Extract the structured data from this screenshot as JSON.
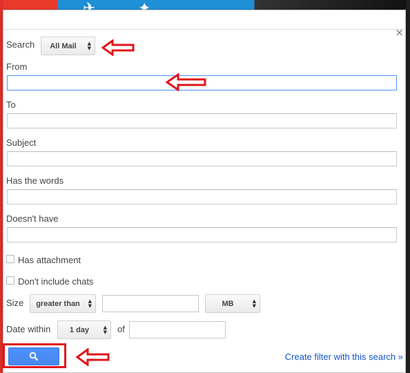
{
  "dialog": {
    "close_label": "×",
    "search_label": "Search",
    "search_scope": "All Mail",
    "from_label": "From",
    "from_value": "",
    "to_label": "To",
    "subject_label": "Subject",
    "has_words_label": "Has the words",
    "doesnt_have_label": "Doesn't have",
    "has_attachment_label": "Has attachment",
    "dont_include_chats_label": "Don't include chats",
    "size_label": "Size",
    "size_operator": "greater than",
    "size_unit": "MB",
    "date_within_label": "Date within",
    "date_within_value": "1 day",
    "of_label": "of",
    "create_filter_link": "Create filter with this search »"
  },
  "colors": {
    "annotation_red": "#e0161b",
    "search_button_blue": "#4d90fe",
    "link_blue": "#1155cc"
  },
  "icons": {
    "search_button_icon": "search-icon"
  }
}
